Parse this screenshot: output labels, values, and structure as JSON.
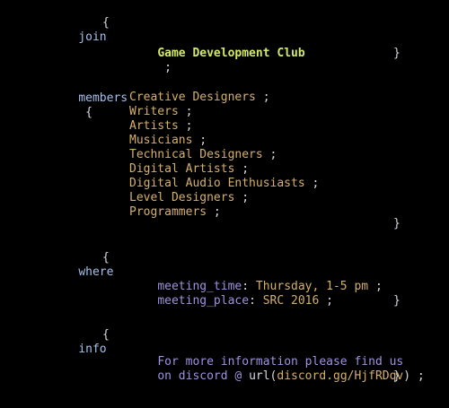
{
  "colors": {
    "background": "#000000",
    "keyword": "#a7c0ec",
    "brace": "#d7d9e4",
    "title": "#d4e86a",
    "item": "#d4b06a",
    "property": "#9e93e0"
  },
  "join": {
    "keyword": "join",
    "open": "{",
    "value": "Game Development Club",
    "semicolon": ";",
    "close": "}"
  },
  "members": {
    "keyword": "members",
    "open": "{",
    "items": [
      "Creative Designers",
      "Writers",
      "Artists",
      "Musicians",
      "Technical Designers",
      "Digital Artists",
      "Digital Audio Enthusiasts",
      "Level Designers",
      "Programmers"
    ],
    "semicolon": ";",
    "close": "}"
  },
  "where": {
    "keyword": "where",
    "open": "{",
    "meeting_time_key": "meeting_time",
    "meeting_time_value": "Thursday, 1-5 pm",
    "meeting_place_key": "meeting_place",
    "meeting_place_value": "SRC 2016",
    "colon": ":",
    "semicolon": ";",
    "close": "}"
  },
  "info": {
    "keyword": "info",
    "open": "{",
    "line1": "For more information please find us",
    "line2_prefix": "on discord @ ",
    "line2_func": "url(",
    "line2_link": "discord.gg/HjfRDqv",
    "line2_close": ")",
    "semicolon": ";",
    "close": "}"
  }
}
